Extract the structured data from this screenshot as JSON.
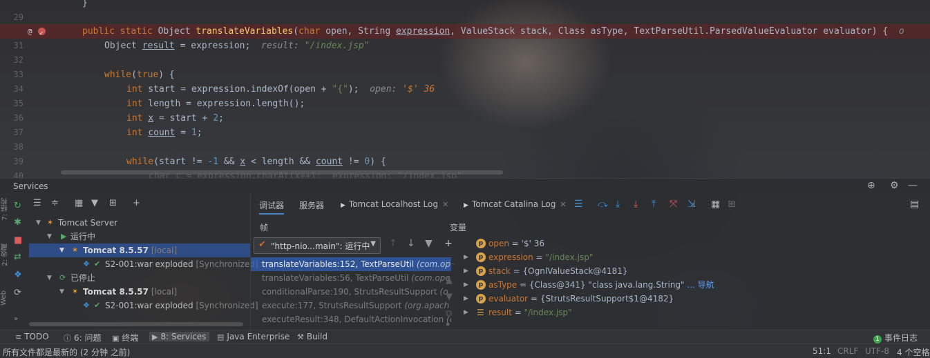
{
  "editor": {
    "lines": [
      {
        "no": "29"
      },
      {
        "no": "31"
      },
      {
        "no": "32"
      },
      {
        "no": "33"
      },
      {
        "no": "34"
      },
      {
        "no": "35"
      },
      {
        "no": "36"
      },
      {
        "no": "37"
      },
      {
        "no": "38"
      },
      {
        "no": "39"
      },
      {
        "no": "40"
      }
    ],
    "gutter_at": "@",
    "code": {
      "l29": "}",
      "l31_mod": "public static",
      "l31_type": "Object",
      "l31_fn": "translateVariables",
      "l31_params_a": "(",
      "l31_char": "char",
      "l31_params_b": " open, String ",
      "l31_expr": "expression",
      "l31_params_c": ", ValueStack stack, Class asType, TextParseUtil.ParsedValueEvaluator evaluator) {",
      "l31_hint": "o",
      "l32_a": "Object ",
      "l32_var": "result",
      "l32_b": " = expression;",
      "l32_hint_lbl": "result: ",
      "l32_hint_val": "\"/index.jsp\"",
      "l34_kw": "while",
      "l34_a": "(",
      "l34_true": "true",
      "l34_b": ") {",
      "l35_int": "int",
      "l35_a": " start = expression.indexOf(open + ",
      "l35_str": "\"{\"",
      "l35_b": ");",
      "l35_hint_lbl": "open: ",
      "l35_hint_val": "'$' 36",
      "l36_int": "int",
      "l36_a": " length = expression.length();",
      "l37_int": "int",
      "l37_var": "x",
      "l37_a": " = start + ",
      "l37_num": "2",
      "l37_b": ";",
      "l38_int": "int",
      "l38_var": "count",
      "l38_a": " = ",
      "l38_num": "1",
      "l38_b": ";",
      "l40_kw": "while",
      "l40_a": "(start != ",
      "l40_num1": "-1",
      "l40_b": " && ",
      "l40_x": "x",
      "l40_c": " < length && ",
      "l40_count": "count",
      "l40_d": " != ",
      "l40_num2": "0",
      "l40_e": ") {",
      "l41_partial": "char c = expression.charAt(x++);  expression: \"/index.jsp\""
    }
  },
  "services": {
    "title": "Services",
    "tree": [
      {
        "label": "Tomcat Server"
      },
      {
        "label": "运行中"
      },
      {
        "label": "Tomcat 8.5.57",
        "suffix": "[local]"
      },
      {
        "label": "S2-001:war exploded",
        "suffix": "[Synchronized]"
      },
      {
        "label": "已停止"
      },
      {
        "label": "Tomcat 8.5.57",
        "suffix": "[local]"
      },
      {
        "label": "S2-001:war exploded",
        "suffix": "[Synchronized]"
      }
    ],
    "left_vertical_tabs": [
      "7: 结构",
      "2: 收藏",
      "Web"
    ]
  },
  "debugger": {
    "tabs": [
      "调试器",
      "服务器",
      "Tomcat Localhost Log",
      "Tomcat Catalina Log"
    ],
    "frames_header": "帧",
    "variables_header": "变量",
    "thread_combo": "\"http-nio...main\": 运行中",
    "frames": [
      {
        "method": "translateVariables:152, TextParseUtil",
        "pkg": "(com.op"
      },
      {
        "method": "translateVariables:56, TextParseUtil",
        "pkg": "(com.ope"
      },
      {
        "method": "conditionalParse:190, StrutsResultSupport",
        "pkg": "(o"
      },
      {
        "method": "execute:177, StrutsResultSupport",
        "pkg": "(org.apach"
      },
      {
        "method": "executeResult:348, DefaultActionInvocation",
        "pkg": "(c"
      }
    ],
    "variables": [
      {
        "name": "open",
        "eq": " = ",
        "value": "'$' 36",
        "kind": "plain"
      },
      {
        "name": "expression",
        "eq": " = ",
        "value": "\"/index.jsp\"",
        "kind": "str"
      },
      {
        "name": "stack",
        "eq": " = ",
        "value": "{OgnlValueStack@4181}",
        "kind": "plain"
      },
      {
        "name": "asType",
        "eq": " = ",
        "value": "{Class@341} \"class java.lang.String\"",
        "kind": "plain",
        "link": "... 导航"
      },
      {
        "name": "evaluator",
        "eq": " = ",
        "value": "{StrutsResultSupport$1@4182}",
        "kind": "plain"
      },
      {
        "name": "result",
        "eq": " = ",
        "value": "\"/index.jsp\"",
        "kind": "str"
      }
    ]
  },
  "bottom_tabs": {
    "todo": "TODO",
    "problems": "6: 问题",
    "terminal": "终端",
    "services": "8: Services",
    "java_ee": "Java Enterprise",
    "build": "Build",
    "event_log": "事件日志",
    "event_count": "1"
  },
  "status": {
    "message": "所有文件都是最新的 (2 分钟 之前)",
    "position": "51:1",
    "line_sep": "CRLF",
    "encoding": "UTF-8",
    "indent": "4 个空格"
  },
  "colors": {
    "keyword": "#cc7832",
    "function": "#ffc66d",
    "string": "#6a8759",
    "number": "#6897bb",
    "selection": "#2f65ca",
    "breakpoint": "#c75450"
  }
}
